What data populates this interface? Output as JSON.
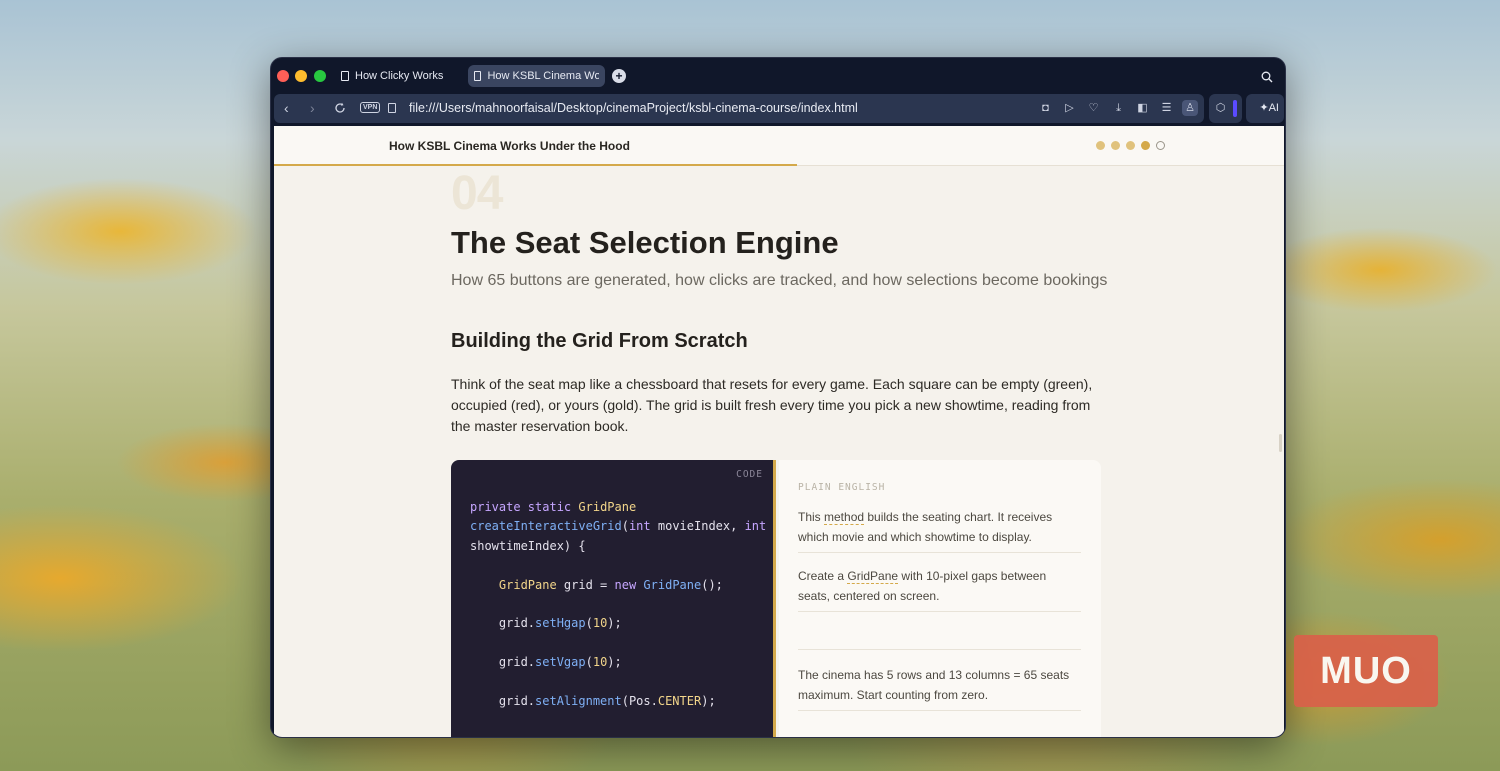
{
  "browser": {
    "tabs": [
      {
        "label": "How Clicky Works"
      },
      {
        "label": "How KSBL Cinema Work"
      }
    ],
    "url": "file:///Users/mahnoorfaisal/Desktop/cinemaProject/ksbl-cinema-course/index.html",
    "vpn_label": "VPN",
    "ai_label": "AI",
    "new_tab": "+"
  },
  "page": {
    "header_title": "How KSBL Cinema Works Under the Hood",
    "section_number": "04",
    "title": "The Seat Selection Engine",
    "subtitle": "How 65 buttons are generated, how clicks are tracked, and how selections become bookings",
    "heading": "Building the Grid From Scratch",
    "paragraph": "Think of the seat map like a chessboard that resets for every game. Each square can be empty (green), occupied (red), or yours (gold). The grid is built fresh every time you pick a new showtime, reading from the master reservation book.",
    "code_label": "CODE",
    "plain_label": "PLAIN ENGLISH",
    "notes": {
      "n1_a": "This ",
      "n1_b": "method",
      "n1_c": " builds the seating chart. It receives which movie and which showtime to display.",
      "n2_a": "Create a ",
      "n2_b": "GridPane",
      "n2_c": " with 10-pixel gaps between seats, centered on screen.",
      "n4": "The cinema has 5 rows and 13 columns = 65 seats maximum. Start counting from zero."
    }
  },
  "watermark": "MUO",
  "colors": {
    "accent": "#d4a94a",
    "code_bg": "#221e30",
    "page_bg": "#f5f2ec"
  }
}
